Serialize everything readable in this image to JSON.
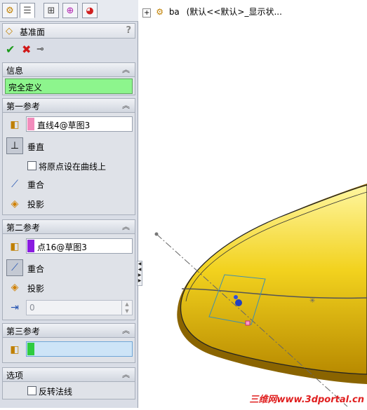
{
  "tabs": [
    {
      "icon": "feature-tree-icon"
    },
    {
      "icon": "property-manager-icon"
    },
    {
      "icon": "configuration-manager-icon"
    },
    {
      "icon": "dimxpert-icon"
    },
    {
      "icon": "display-manager-icon"
    }
  ],
  "panel": {
    "title": "基准面",
    "help": "?"
  },
  "info": {
    "header": "信息",
    "status": "完全定义",
    "status_color": "#8df58d"
  },
  "first_ref": {
    "header": "第一参考",
    "selection": "直线4@草图3",
    "swatch_color": "#f28cbc",
    "perpendicular_label": "垂直",
    "origin_checkbox_label": "将原点设在曲线上",
    "coincident_label": "重合",
    "project_label": "投影"
  },
  "second_ref": {
    "header": "第二参考",
    "selection": "点16@草图3",
    "swatch_color": "#8a1ce0",
    "coincident_label": "重合",
    "project_label": "投影",
    "distance_value": "0"
  },
  "third_ref": {
    "header": "第三参考",
    "selection": "",
    "swatch_color": "#2ecc40"
  },
  "options": {
    "header": "选项",
    "flip_normal_label": "反转法线"
  },
  "tree": {
    "part_name": "ba",
    "config_text": "(默认<<默认>_显示状..."
  },
  "watermark": "三维网www.3dportal.cn"
}
